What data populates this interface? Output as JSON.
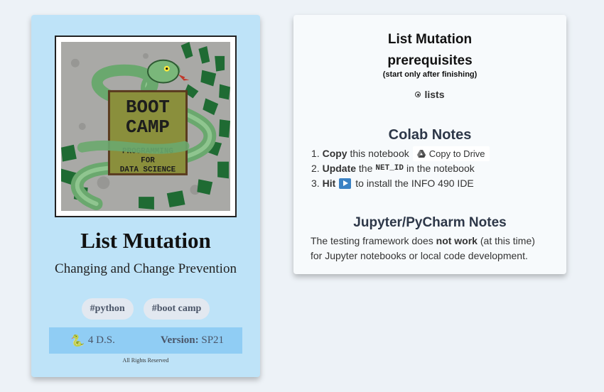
{
  "book": {
    "cover_alt": "BOOT CAMP PROGRAMMING FOR DATA SCIENCE",
    "cover_line1": "BOOT",
    "cover_line2": "CAMP",
    "cover_line3": "PROGRAMMING",
    "cover_line4": "FOR",
    "cover_line5": "DATA SCIENCE",
    "title": "List Mutation",
    "subtitle": "Changing and Change Prevention",
    "tags": [
      "#python",
      "#boot camp"
    ],
    "author_icon": "🐍",
    "author": "4 D.S.",
    "version_label": "Version:",
    "version_value": "SP21",
    "rights": "All Rights Reserved"
  },
  "prerequisites": {
    "title_line1": "List Mutation",
    "title_line2": "prerequisites",
    "note": "(start only after finishing)",
    "items": [
      "lists"
    ]
  },
  "colab": {
    "title": "Colab Notes",
    "step1_num": "1.",
    "step1_bold": "Copy",
    "step1_text": "this notebook",
    "step1_button": "Copy to Drive",
    "step2_num": "2.",
    "step2_bold": "Update",
    "step2_pre": "the",
    "step2_code": "NET_ID",
    "step2_post": "in the notebook",
    "step3_num": "3.",
    "step3_bold": "Hit",
    "step3_text": "to install the INFO 490 IDE"
  },
  "jupyter": {
    "title": "Jupyter/PyCharm Notes",
    "text_pre": "The testing framework does",
    "text_bold": "not work",
    "text_post": "(at this time)",
    "text_line2": "for Jupyter notebooks or local code development."
  },
  "colors": {
    "left_card_bg": "#bee3f8",
    "meta_bar_bg": "#90cdf4",
    "page_bg": "#edf2f7",
    "tag_bg": "#e2e8f0"
  }
}
